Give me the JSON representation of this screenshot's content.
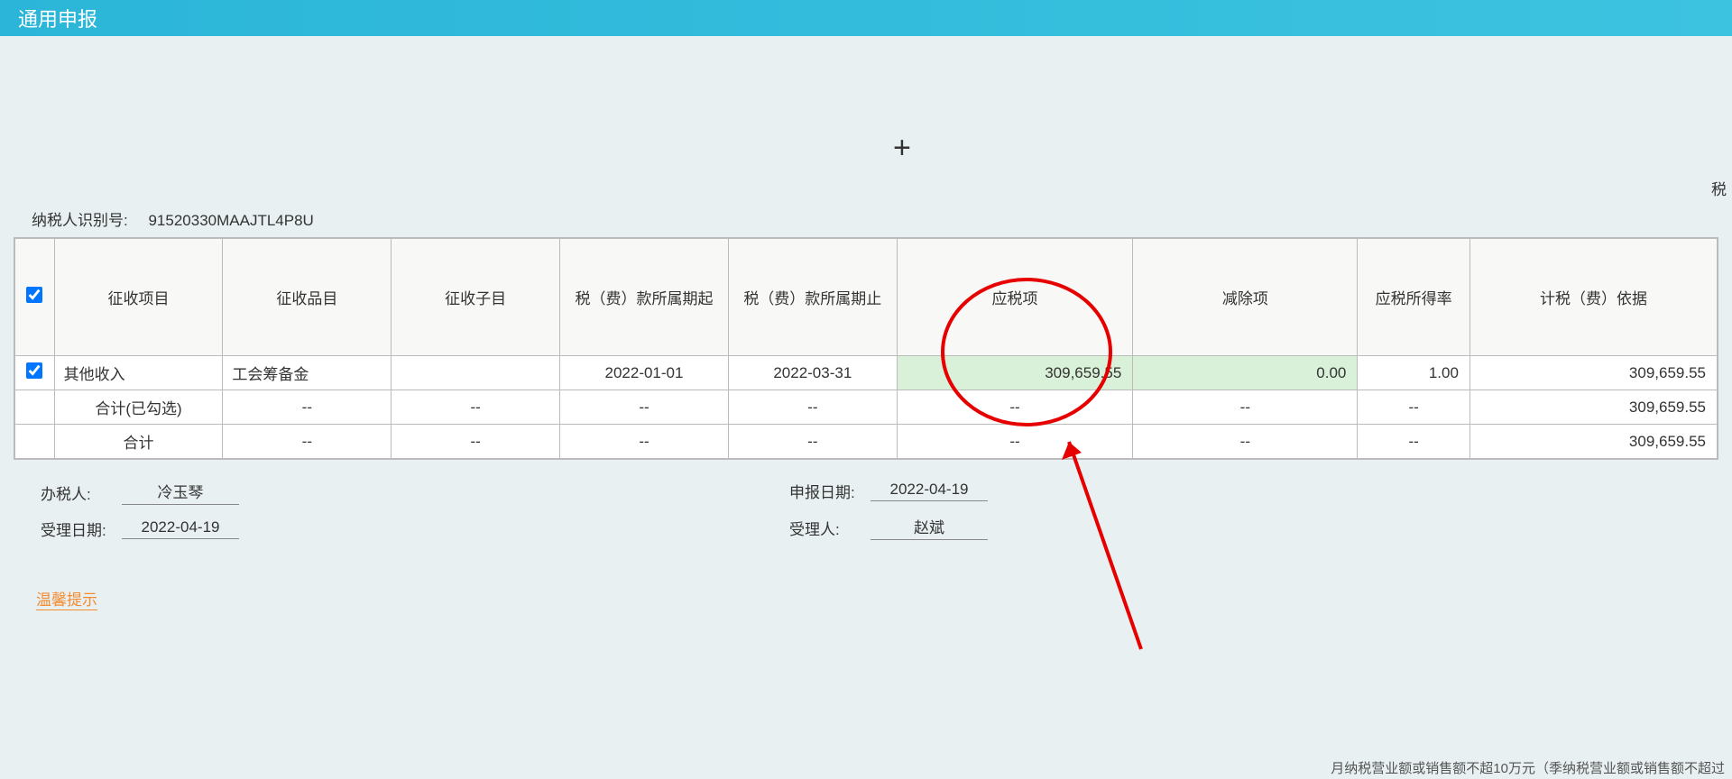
{
  "header": {
    "title_partial": "通用申报"
  },
  "taxpayer": {
    "id_label": "纳税人识别号:",
    "id_value": "91520330MAAJTL4P8U"
  },
  "right_label_partial": "税",
  "table": {
    "headers": {
      "col_item": "征收项目",
      "col_prod": "征收品目",
      "col_sub": "征收子目",
      "col_start": "税（费）款所属期起",
      "col_end": "税（费）款所属期止",
      "col_tax": "应税项",
      "col_ded": "减除项",
      "col_rate": "应税所得率",
      "col_basis": "计税（费）依据"
    },
    "rows": [
      {
        "checked": true,
        "item": "其他收入",
        "prod": "工会筹备金",
        "sub": "",
        "start": "2022-01-01",
        "end": "2022-03-31",
        "tax": "309,659.55",
        "ded": "0.00",
        "rate": "1.00",
        "basis": "309,659.55"
      },
      {
        "item": "合计(已勾选)",
        "prod": "--",
        "sub": "--",
        "start": "--",
        "end": "--",
        "tax": "--",
        "ded": "--",
        "rate": "--",
        "basis": "309,659.55"
      },
      {
        "item": "合计",
        "prod": "--",
        "sub": "--",
        "start": "--",
        "end": "--",
        "tax": "--",
        "ded": "--",
        "rate": "--",
        "basis": "309,659.55"
      }
    ]
  },
  "footer": {
    "left": {
      "handler_label": "办税人:",
      "handler_value": "冷玉琴",
      "accept_date_label": "受理日期:",
      "accept_date_value": "2022-04-19"
    },
    "right": {
      "declare_date_label": "申报日期:",
      "declare_date_value": "2022-04-19",
      "acceptor_label": "受理人:",
      "acceptor_value": "赵斌"
    }
  },
  "warm_tip": "温馨提示",
  "bottom_partial": "月纳税营业额或销售额不超10万元（季纳税营业额或销售额不超过"
}
